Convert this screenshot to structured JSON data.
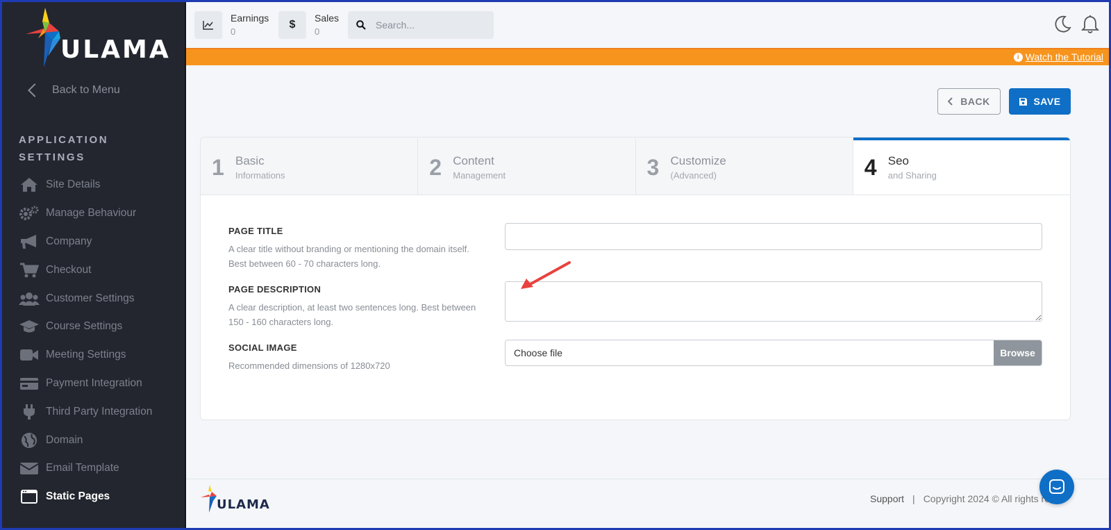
{
  "brand": {
    "logo_text": "ULAMA"
  },
  "sidebar": {
    "back_label": "Back to Menu",
    "section_title": "APPLICATION SETTINGS",
    "items": [
      {
        "label": "Site Details",
        "icon": "home-icon"
      },
      {
        "label": "Manage Behaviour",
        "icon": "gears-icon"
      },
      {
        "label": "Company",
        "icon": "megaphone-icon"
      },
      {
        "label": "Checkout",
        "icon": "cart-icon"
      },
      {
        "label": "Customer Settings",
        "icon": "users-icon"
      },
      {
        "label": "Course Settings",
        "icon": "graduation-cap-icon"
      },
      {
        "label": "Meeting Settings",
        "icon": "video-icon"
      },
      {
        "label": "Payment Integration",
        "icon": "card-icon"
      },
      {
        "label": "Third Party Integration",
        "icon": "plug-icon"
      },
      {
        "label": "Domain",
        "icon": "globe-icon"
      },
      {
        "label": "Email Template",
        "icon": "envelope-icon"
      },
      {
        "label": "Static Pages",
        "icon": "window-icon",
        "active": true
      }
    ]
  },
  "topbar": {
    "earnings_label": "Earnings",
    "earnings_value": "0",
    "sales_label": "Sales",
    "sales_value": "0",
    "search_placeholder": "Search..."
  },
  "banner": {
    "tutorial_link": "Watch the Tutorial"
  },
  "actions": {
    "back_label": "BACK",
    "save_label": "SAVE"
  },
  "steps": [
    {
      "num": "1",
      "title": "Basic",
      "subtitle": "Informations"
    },
    {
      "num": "2",
      "title": "Content",
      "subtitle": "Management"
    },
    {
      "num": "3",
      "title": "Customize",
      "subtitle": "(Advanced)"
    },
    {
      "num": "4",
      "title": "Seo",
      "subtitle": "and Sharing",
      "active": true
    }
  ],
  "form": {
    "page_title_label": "PAGE TITLE",
    "page_title_help": "A clear title without branding or mentioning the domain itself. Best between 60 - 70 characters long.",
    "page_title_value": "",
    "page_description_label": "PAGE DESCRIPTION",
    "page_description_help": "A clear description, at least two sentences long. Best between 150 - 160 characters long.",
    "page_description_value": "",
    "social_image_label": "SOCIAL IMAGE",
    "social_image_help": "Recommended dimensions of 1280x720",
    "file_placeholder": "Choose file",
    "browse_label": "Browse"
  },
  "footer": {
    "support_label": "Support",
    "separator": "|",
    "copyright": "Copyright 2024 © All rights res"
  },
  "colors": {
    "sidebar_bg": "#23262f",
    "accent": "#0f6fc6",
    "banner": "#f7941d",
    "annotation_arrow": "#e8423f"
  }
}
